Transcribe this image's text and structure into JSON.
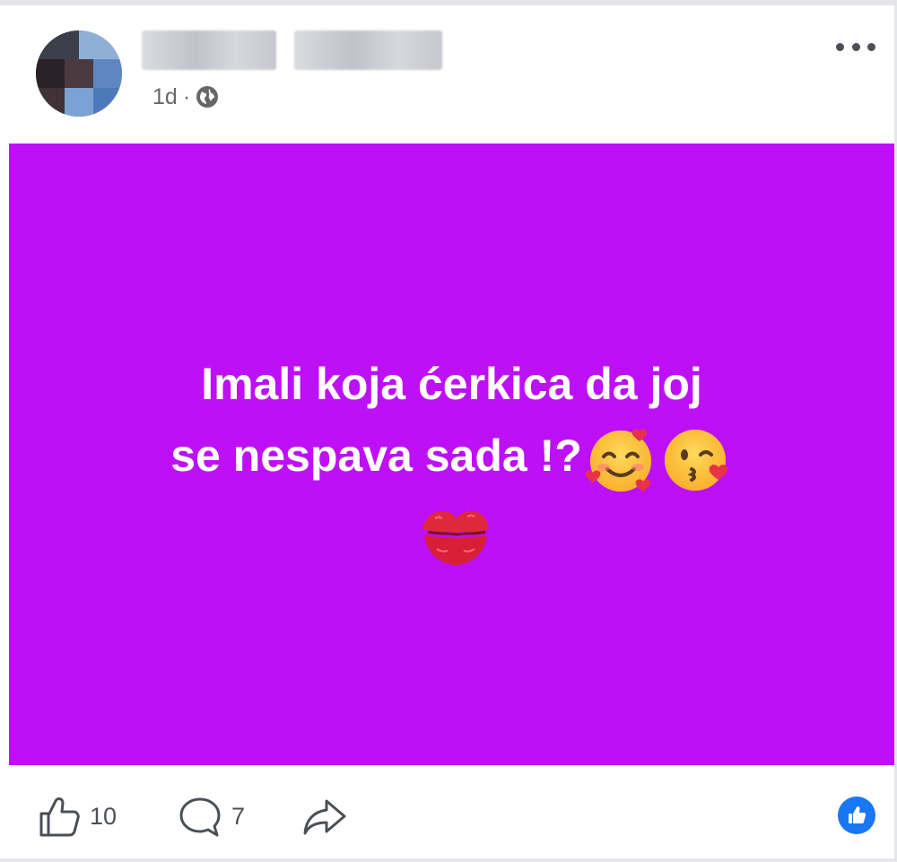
{
  "post": {
    "author": {
      "name_blurred": true,
      "avatar_blurred": true
    },
    "time": "1d",
    "separator": "·",
    "audience_icon": "globe-icon",
    "menu_icon": "more-horizontal-icon",
    "background_color": "#bd10f7",
    "text_color": "#ffffff",
    "text_lines": [
      "Imali koja ćerkica da joj",
      "se nespava sada !?"
    ],
    "emojis": [
      "smiling-face-with-hearts-emoji",
      "face-blowing-kiss-emoji",
      "kiss-mark-emoji"
    ]
  },
  "actions": {
    "like_icon": "thumbs-up-icon",
    "like_count": "10",
    "comment_icon": "comment-bubble-icon",
    "comment_count": "7",
    "share_icon": "share-arrow-icon",
    "reaction_badge_icon": "like-reaction-icon",
    "reaction_color": "#1877f2"
  }
}
